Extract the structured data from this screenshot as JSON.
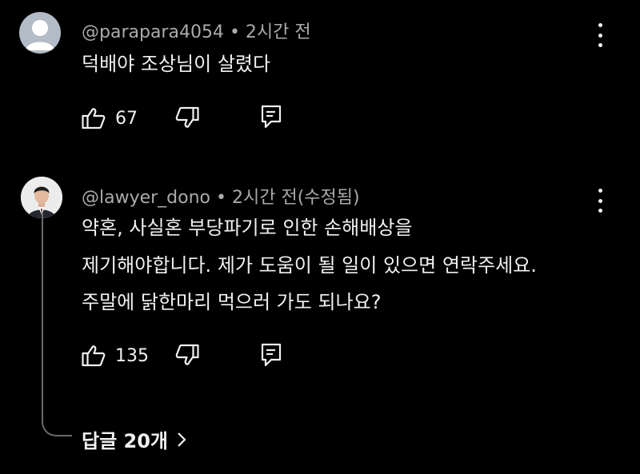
{
  "comments": [
    {
      "handle": "@parapara4054",
      "time": "• 2시간 전",
      "lines": [
        "덕배야 조상님이 살렸다"
      ],
      "likes": "67",
      "avatar_icon": "default-avatar-icon",
      "avatar_bg": "#b2bcc6"
    },
    {
      "handle": "@lawyer_dono",
      "time": "• 2시간 전(수정됨)",
      "lines": [
        "약혼, 사실혼 부당파기로 인한 손해배상을",
        "제기해야합니다. 제가 도움이 될 일이 있으면 연락주세요.",
        "주말에 닭한마리 먹으러 가도 되나요?"
      ],
      "likes": "135",
      "avatar_icon": "lawyer-photo-avatar"
    }
  ],
  "replies": {
    "label": "답글 20개"
  },
  "icons": [
    "like-icon",
    "dislike-icon",
    "reply-icon",
    "more-vert-icon",
    "chevron-right-icon"
  ]
}
